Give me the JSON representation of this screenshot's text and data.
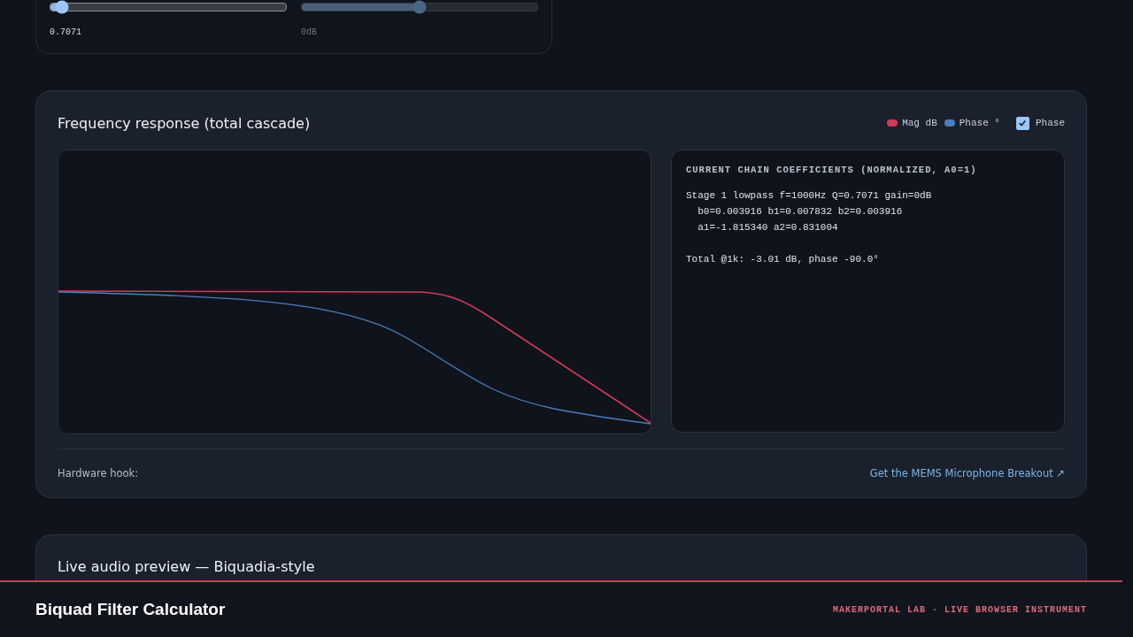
{
  "controls": {
    "sliders": [
      {
        "level": 0.05,
        "reading": "0.7071",
        "active": true
      },
      {
        "level": 0.5,
        "reading": "0dB",
        "active": false
      }
    ]
  },
  "response": {
    "title": "Frequency response (total cascade)",
    "legend": [
      {
        "label": "Mag dB",
        "color": "#d03a58"
      },
      {
        "label": "Phase °",
        "color": "#4a7fc0"
      }
    ],
    "phase_toggle": {
      "label": "Phase",
      "checked": true
    },
    "coefficients": {
      "heading": "CURRENT CHAIN COEFFICIENTS (NORMALIZED, A0=1)",
      "blocks": [
        [
          "Stage 1 lowpass f=1000Hz Q=0.7071 gain=0dB",
          "  b0=0.003916 b1=0.007832 b2=0.003916",
          "  a1=-1.815340 a2=0.831004"
        ],
        [
          "Total @1k: -3.01 dB, phase -90.0°"
        ]
      ]
    },
    "hook_label": "Hardware hook:",
    "hook_link": "Get the MEMS Microphone Breakout ↗"
  },
  "preview": {
    "title": "Live audio preview — Biquadia-style"
  },
  "footer": {
    "title": "Biquad Filter Calculator",
    "tagline": "MAKERPORTAL LAB · LIVE BROWSER INSTRUMENT"
  }
}
